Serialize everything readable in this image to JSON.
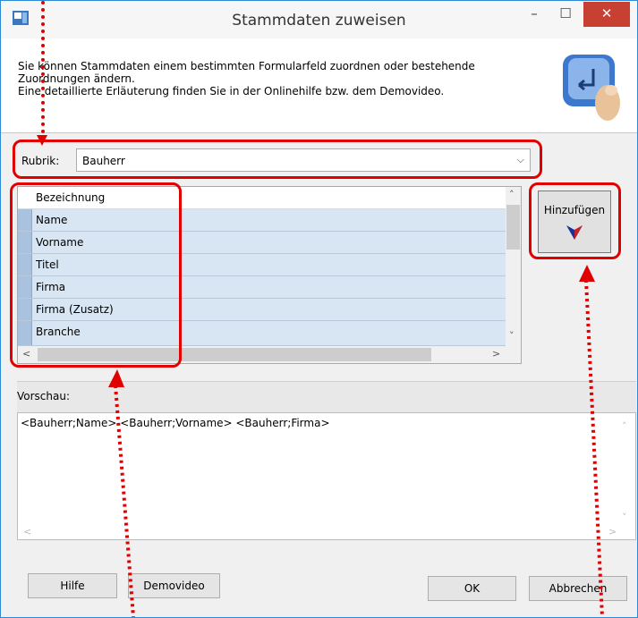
{
  "window": {
    "title": "Stammdaten zuweisen"
  },
  "titlebar": {
    "minimize": "–",
    "maximize": "☐",
    "close": "✕"
  },
  "header": {
    "description": "Sie können Stammdaten einem bestimmten Formularfeld zuordnen oder bestehende\nZuordnungen ändern.\nEine detaillierte Erläuterung finden Sie in der Onlinehilfe bzw. dem Demovideo."
  },
  "rubrik": {
    "label": "Rubrik:",
    "selected": "Bauherr"
  },
  "grid": {
    "column_header": "Bezeichnung",
    "rows": [
      "Name",
      "Vorname",
      "Titel",
      "Firma",
      "Firma (Zusatz)",
      "Branche"
    ]
  },
  "add_button": {
    "label": "Hinzufügen"
  },
  "preview": {
    "label": "Vorschau:",
    "text": "<Bauherr;Name> <Bauherr;Vorname> <Bauherr;Firma>"
  },
  "footer": {
    "help": "Hilfe",
    "demovideo": "Demovideo",
    "ok": "OK",
    "cancel": "Abbrechen"
  },
  "colors": {
    "accent": "#2c8ad6",
    "close": "#c84031",
    "annotation": "#e00000",
    "row": "#d8e6f3"
  },
  "icons": [
    "app-icon",
    "keyboard-enter-icon",
    "arrow-down-icon"
  ]
}
